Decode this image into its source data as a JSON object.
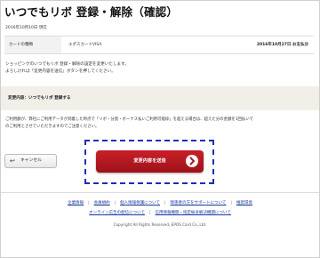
{
  "page": {
    "title": "いつでもリボ 登録・解除（確認）",
    "date_line": "2016年10月10日 現在"
  },
  "info": {
    "label": "カードの種類",
    "card_name": "エポスカードVISA",
    "date": "2016年10月27日 お支払分"
  },
  "description": {
    "line1": "ショッピングのいつでもリボ 登録・解除の設定を変更いたします。",
    "line2": "よろしければ「変更内容を送信」ボタンを押してください。"
  },
  "change": {
    "text": "変更内容：いつでもリボ 登録する"
  },
  "notice": {
    "line1": "ご利用額が、弊社にご利用データが到着した時点で「リボ・分割・ボーナス払いご利用可能枠」を超える場合は、超えた分の金額を1回払いで",
    "line2": "のご利用とさせていただきますのでご注意ください。"
  },
  "buttons": {
    "cancel_label": "キャンセル",
    "cancel_icon": "↩",
    "submit_label": "変更内容を送信"
  },
  "footer": {
    "row1": [
      "企業情報",
      "会員規約",
      "個人情報保護について",
      "障害者の方をサポートについて",
      "推奨環境"
    ],
    "row2": [
      "オンライン広告の配信について",
      "信用情報機関・指定紛争解決機関について"
    ],
    "copyright": "Copyright All Rights Reserved, EPOS Card Co.,Ltd."
  },
  "colors": {
    "submit_button": "#b5161f",
    "focus_ring": "#1a2fb5",
    "link": "#1a3a9e",
    "change_box_bg": "#f2efe9"
  }
}
